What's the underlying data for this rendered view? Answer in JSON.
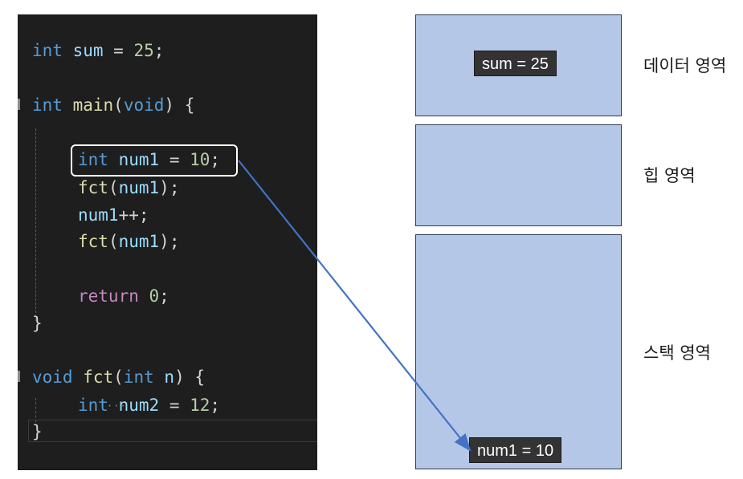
{
  "code": {
    "global_decl": {
      "type": "int",
      "name": "sum",
      "op": " = ",
      "value": "25",
      "end": ";"
    },
    "main_sig": {
      "type": "int",
      "name": "main",
      "open": "(",
      "param": "void",
      "close": ") {"
    },
    "main_body": {
      "decl": {
        "type": "int",
        "name": "num1",
        "op": " = ",
        "value": "10",
        "end": ";"
      },
      "call1": {
        "fn": "fct",
        "open": "(",
        "arg": "num1",
        "close": ");"
      },
      "incr": {
        "var": "num1",
        "op": "++;"
      },
      "call2": {
        "fn": "fct",
        "open": "(",
        "arg": "num1",
        "close": ");"
      },
      "ret": {
        "kw": "return",
        "value": "0",
        "end": ";"
      }
    },
    "main_close": "}",
    "fct_sig": {
      "type": "void",
      "name": "fct",
      "open": "(",
      "ptype": "int",
      "pname": "n",
      "close": ") {"
    },
    "fct_body": {
      "type": "int",
      "name": "num2",
      "op": " = ",
      "value": "12",
      "end": ";"
    },
    "fct_close": "}"
  },
  "memory": {
    "data": {
      "label": "데이터 영역",
      "chip": "sum = 25"
    },
    "heap": {
      "label": "힙 영역"
    },
    "stack": {
      "label": "스택 영역",
      "chip": "num1 = 10"
    }
  },
  "colors": {
    "region_fill": "#b4c7e7",
    "arrow": "#4472c4",
    "code_bg": "#1e1e1e"
  }
}
